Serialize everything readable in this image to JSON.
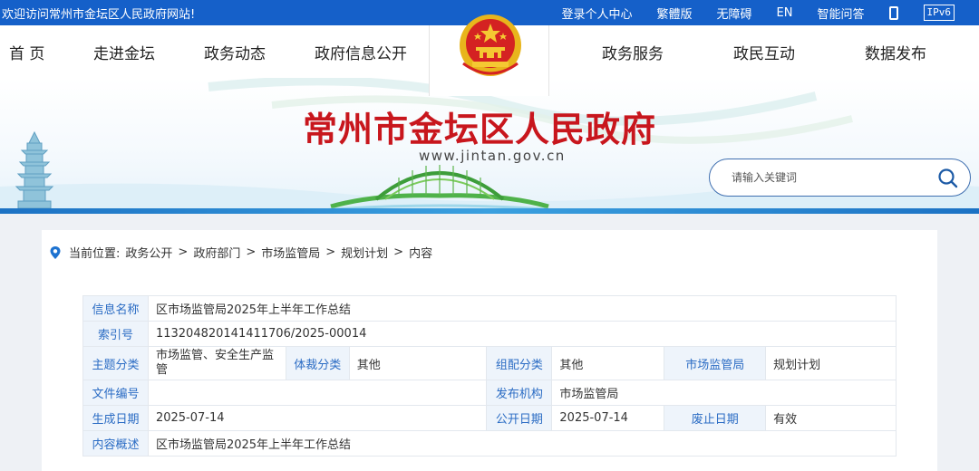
{
  "topbar": {
    "welcome": "欢迎访问常州市金坛区人民政府网站!",
    "links": [
      "登录个人中心",
      "繁體版",
      "无障碍",
      "EN",
      "智能问答"
    ],
    "ipv6": "IPv6"
  },
  "nav": {
    "items": [
      "首 页",
      "走进金坛",
      "政务动态",
      "政府信息公开",
      "政务服务",
      "政民互动",
      "数据发布"
    ]
  },
  "header": {
    "title": "常州市金坛区人民政府",
    "domain": "www.jintan.gov.cn"
  },
  "search": {
    "placeholder": "请输入关键词"
  },
  "breadcrumb": {
    "label": "当前位置:",
    "items": [
      "政务公开",
      "政府部门",
      "市场监管局",
      "规划计划",
      "内容"
    ],
    "separator": ">"
  },
  "info": {
    "title_label": "信息名称",
    "title_value": "区市场监管局2025年上半年工作总结",
    "index_label": "索引号",
    "index_value": "113204820141411706/2025-00014",
    "topic_label": "主题分类",
    "topic_value": "市场监管、安全生产监管",
    "genre_label": "体裁分类",
    "genre_value": "其他",
    "assoc_label": "组配分类",
    "assoc_value": "其他",
    "dept_label": "市场监管局",
    "dept_value": "规划计划",
    "docno_label": "文件编号",
    "docno_value": "",
    "publisher_label": "发布机构",
    "publisher_value": "市场监管局",
    "created_label": "生成日期",
    "created_value": "2025-07-14",
    "public_label": "公开日期",
    "public_value": "2025-07-14",
    "expire_label": "废止日期",
    "expire_value": "有效",
    "summary_label": "内容概述",
    "summary_value": "区市场监管局2025年上半年工作总结"
  },
  "colors": {
    "topbar": "#1560c9",
    "title_red": "#c8161d",
    "label_blue": "#2b6cc4",
    "label_bg": "#eef4fb"
  },
  "icons": {
    "phone": "mobile-phone-icon",
    "search": "search-icon",
    "location": "location-pin-icon",
    "emblem": "national-emblem-icon"
  }
}
